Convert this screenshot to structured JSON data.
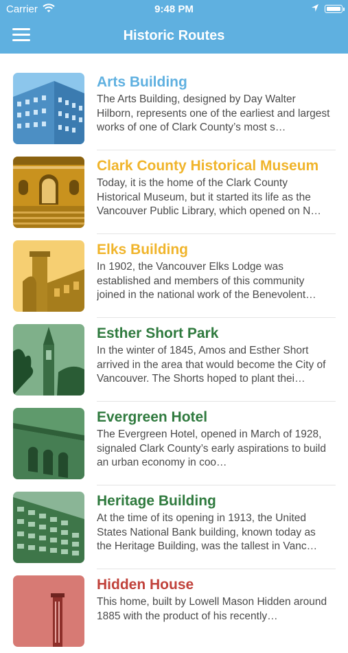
{
  "status": {
    "carrier": "Carrier",
    "time": "9:48 PM"
  },
  "nav": {
    "title": "Historic Routes"
  },
  "colors": {
    "nav_bg": "#5fb0e0",
    "blue": "#5fb0e0",
    "yellow": "#f0b42a",
    "green": "#2f7a3e",
    "red": "#c0413a"
  },
  "routes": [
    {
      "title": "Arts Building",
      "color": "#5fb0e0",
      "description": "The Arts Building, designed by Day Walter Hilborn, represents one of the earliest and largest works of one of Clark County’s most s…"
    },
    {
      "title": "Clark County Historical Museum",
      "color": "#f0b42a",
      "description": "Today, it is the home of the Clark County Historical Museum, but it started its life as the Vancouver Public Library, which opened on N…"
    },
    {
      "title": "Elks Building",
      "color": "#f0b42a",
      "description": "In 1902, the Vancouver Elks Lodge was established and members of this community joined in the national work of the Benevolent…"
    },
    {
      "title": "Esther Short Park",
      "color": "#2f7a3e",
      "description": "In the winter of 1845, Amos and Esther Short arrived in the area that would become the City of Vancouver. The Shorts hoped to plant thei…"
    },
    {
      "title": "Evergreen Hotel",
      "color": "#2f7a3e",
      "description": "The Evergreen Hotel, opened in March of 1928, signaled Clark County’s early aspirations to build an urban economy in coo…"
    },
    {
      "title": "Heritage Building",
      "color": "#2f7a3e",
      "description": "At the time of its opening in 1913, the United States National Bank building, known today as the Heritage Building, was the tallest in Vanc…"
    },
    {
      "title": "Hidden House",
      "color": "#c0413a",
      "description": "This home, built by Lowell Mason Hidden around 1885 with the product of his recently…"
    }
  ]
}
